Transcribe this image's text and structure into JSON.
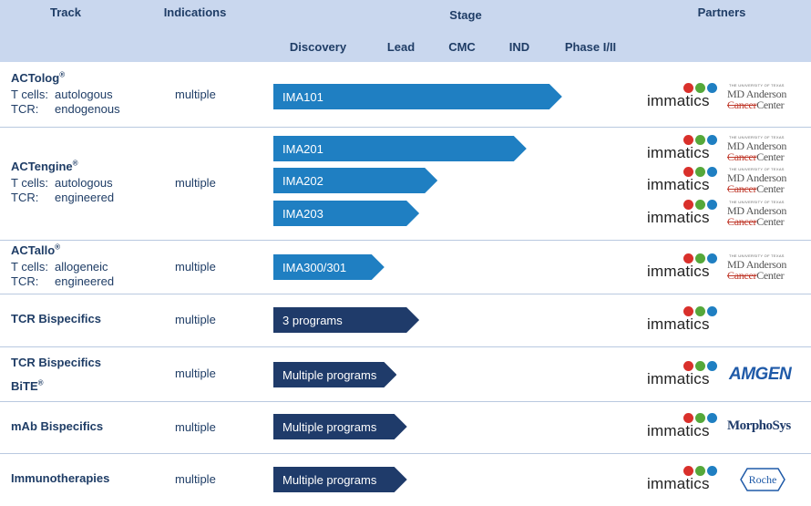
{
  "header": {
    "track": "Track",
    "indications": "Indications",
    "stage": "Stage",
    "partners": "Partners",
    "stages": [
      "Discovery",
      "Lead",
      "CMC",
      "IND",
      "Phase I/II"
    ]
  },
  "rows": [
    {
      "title": "ACTolog",
      "reg": "®",
      "lines": [
        {
          "k": "T cells:",
          "v": "autologous"
        },
        {
          "k": "TCR:",
          "v": "endogenous"
        }
      ],
      "indication": "multiple",
      "bars": [
        {
          "label": "IMA101",
          "progress_stage": 4.6,
          "tone": "light"
        }
      ],
      "partners": [
        [
          "immatics",
          "mdanderson"
        ]
      ]
    },
    {
      "title": "ACTengine",
      "reg": "®",
      "lines": [
        {
          "k": "T cells:",
          "v": "autologous"
        },
        {
          "k": "TCR:",
          "v": "engineered"
        }
      ],
      "indication": "multiple",
      "bars": [
        {
          "label": "IMA201",
          "progress_stage": 4.1,
          "tone": "light"
        },
        {
          "label": "IMA202",
          "progress_stage": 2.6,
          "tone": "light"
        },
        {
          "label": "IMA203",
          "progress_stage": 2.3,
          "tone": "light"
        }
      ],
      "partners": [
        [
          "immatics",
          "mdanderson"
        ],
        [
          "immatics",
          "mdanderson"
        ],
        [
          "immatics",
          "mdanderson"
        ]
      ]
    },
    {
      "title": "ACTallo",
      "reg": "®",
      "lines": [
        {
          "k": "T cells:",
          "v": "allogeneic"
        },
        {
          "k": "TCR:",
          "v": "engineered"
        }
      ],
      "indication": "multiple",
      "bars": [
        {
          "label": "IMA300/301",
          "progress_stage": 1.8,
          "tone": "light"
        }
      ],
      "partners": [
        [
          "immatics",
          "mdanderson"
        ]
      ]
    },
    {
      "title": "TCR Bispecifics",
      "reg": "",
      "lines": [],
      "indication": "multiple",
      "bars": [
        {
          "label": "3 programs",
          "progress_stage": 2.3,
          "tone": "dark"
        }
      ],
      "partners": [
        [
          "immatics"
        ]
      ]
    },
    {
      "title": "TCR Bispecifics",
      "reg": "",
      "subtitle": "BiTE",
      "subtitle_reg": "®",
      "lines": [],
      "indication": "multiple",
      "bars": [
        {
          "label": "Multiple programs",
          "progress_stage": 1.95,
          "tone": "dark"
        }
      ],
      "partners": [
        [
          "immatics",
          "amgen"
        ]
      ]
    },
    {
      "title": "mAb Bispecifics",
      "reg": "",
      "lines": [],
      "indication": "multiple",
      "bars": [
        {
          "label": "Multiple programs",
          "progress_stage": 2.1,
          "tone": "dark"
        }
      ],
      "partners": [
        [
          "immatics",
          "morphosys"
        ]
      ]
    },
    {
      "title": "Immunotherapies",
      "reg": "",
      "lines": [],
      "indication": "multiple",
      "bars": [
        {
          "label": "Multiple programs",
          "progress_stage": 2.1,
          "tone": "dark"
        }
      ],
      "partners": [
        [
          "immatics",
          "roche"
        ]
      ]
    }
  ],
  "logos": {
    "immatics": "immatics",
    "mdanderson_top": "THE UNIVERSITY OF TEXAS",
    "mdanderson_name": "MD Anderson",
    "mdanderson_cancer": "Cancer",
    "mdanderson_center": "Center",
    "amgen": "AMGEN",
    "morphosys": "MorphoSys",
    "roche": "Roche"
  },
  "colors": {
    "header_bg": "#c9d7ee",
    "text": "#1f3d66",
    "bar_light": "#1f7fc2",
    "bar_dark": "#1f3b6a"
  }
}
